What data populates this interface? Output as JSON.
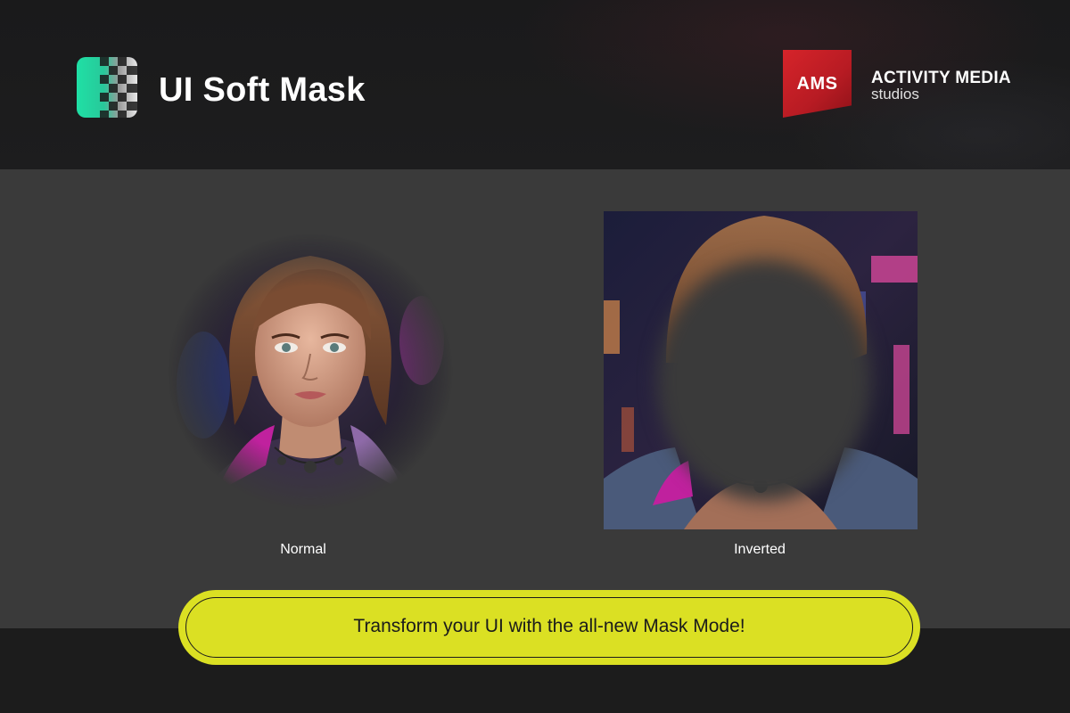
{
  "header": {
    "product_title": "UI Soft Mask",
    "product_logo_icon": "checker-gradient-logo-icon",
    "company_badge": "AMS",
    "company_name": "ACTIVITY MEDIA",
    "company_sub": "studios"
  },
  "examples": [
    {
      "caption": "Normal",
      "image": "portrait-soft-masked-image"
    },
    {
      "caption": "Inverted",
      "image": "portrait-inverted-mask-image"
    }
  ],
  "cta": {
    "label": "Transform your UI with the all-new Mask Mode!"
  },
  "colors": {
    "brand_green": "#1fe0a5",
    "cta_yellow": "#dbe023",
    "ams_red": "#c8202a",
    "panel_gray": "#3a3a3a",
    "dark_band": "#1c1c1c"
  }
}
